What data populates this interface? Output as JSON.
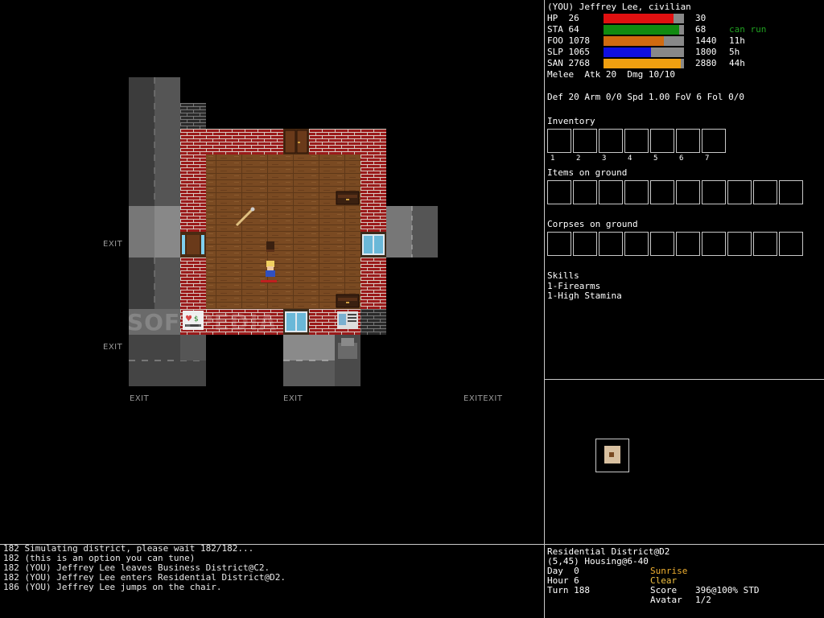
{
  "player": {
    "title": "(YOU) Jeffrey Lee, civilian",
    "stats": [
      {
        "label": "HP  26",
        "max": "30",
        "note": "",
        "fraction": 0.867,
        "color": "#e01010"
      },
      {
        "label": "STA 64",
        "max": "68",
        "note": "can run",
        "fraction": 0.94,
        "color": "#108a10"
      },
      {
        "label": "FOO 1078",
        "max": "1440",
        "note": "11h",
        "fraction": 0.749,
        "color": "#d06a10"
      },
      {
        "label": "SLP 1065",
        "max": "1800",
        "note": "5h",
        "fraction": 0.592,
        "color": "#1010e0"
      },
      {
        "label": "SAN 2768",
        "max": "2880",
        "note": "44h",
        "fraction": 0.961,
        "color": "#f0a010"
      }
    ],
    "melee": "Melee  Atk 20  Dmg 10/10",
    "defense": "Def 20 Arm 0/0 Spd 1.00 FoV 6 Fol 0/0"
  },
  "inventory": {
    "title": "Inventory",
    "slot_numbers": [
      "1",
      "2",
      "3",
      "4",
      "5",
      "6",
      "7"
    ]
  },
  "items_ground": {
    "title": "Items on ground"
  },
  "corpses_ground": {
    "title": "Corpses on ground"
  },
  "skills": {
    "title": "Skills",
    "list": [
      "1-Firearms",
      "1-High Stamina"
    ]
  },
  "map": {
    "exit_label": "EXIT",
    "exit_double": "EXITEXIT",
    "watermark": "SOFTPEDIA"
  },
  "log": [
    "182 Simulating district, please wait 182/182...",
    "182 (this is an option you can tune)",
    "182 (YOU) Jeffrey Lee leaves Business District@C2.",
    "182 (YOU) Jeffrey Lee enters Residential District@D2.",
    "186 (YOU) Jeffrey Lee jumps on the chair."
  ],
  "location": {
    "district": "Residential District@D2",
    "position": "(5,45) Housing@6-40",
    "day_label": "Day  0",
    "day_value": "Sunrise",
    "hour_label": "Hour 6",
    "hour_value": "Clear",
    "turn_label": "Turn 188",
    "score_label": "Score",
    "score_value": "396@100% STD",
    "avatar_label": "Avatar",
    "avatar_value": "1/2"
  },
  "colors": {
    "accent_green": "#20a020",
    "sunrise": "#f0b030",
    "clear": "#f0c040",
    "wall_red": "#9a1a1a",
    "floor": "#7a4a22"
  }
}
